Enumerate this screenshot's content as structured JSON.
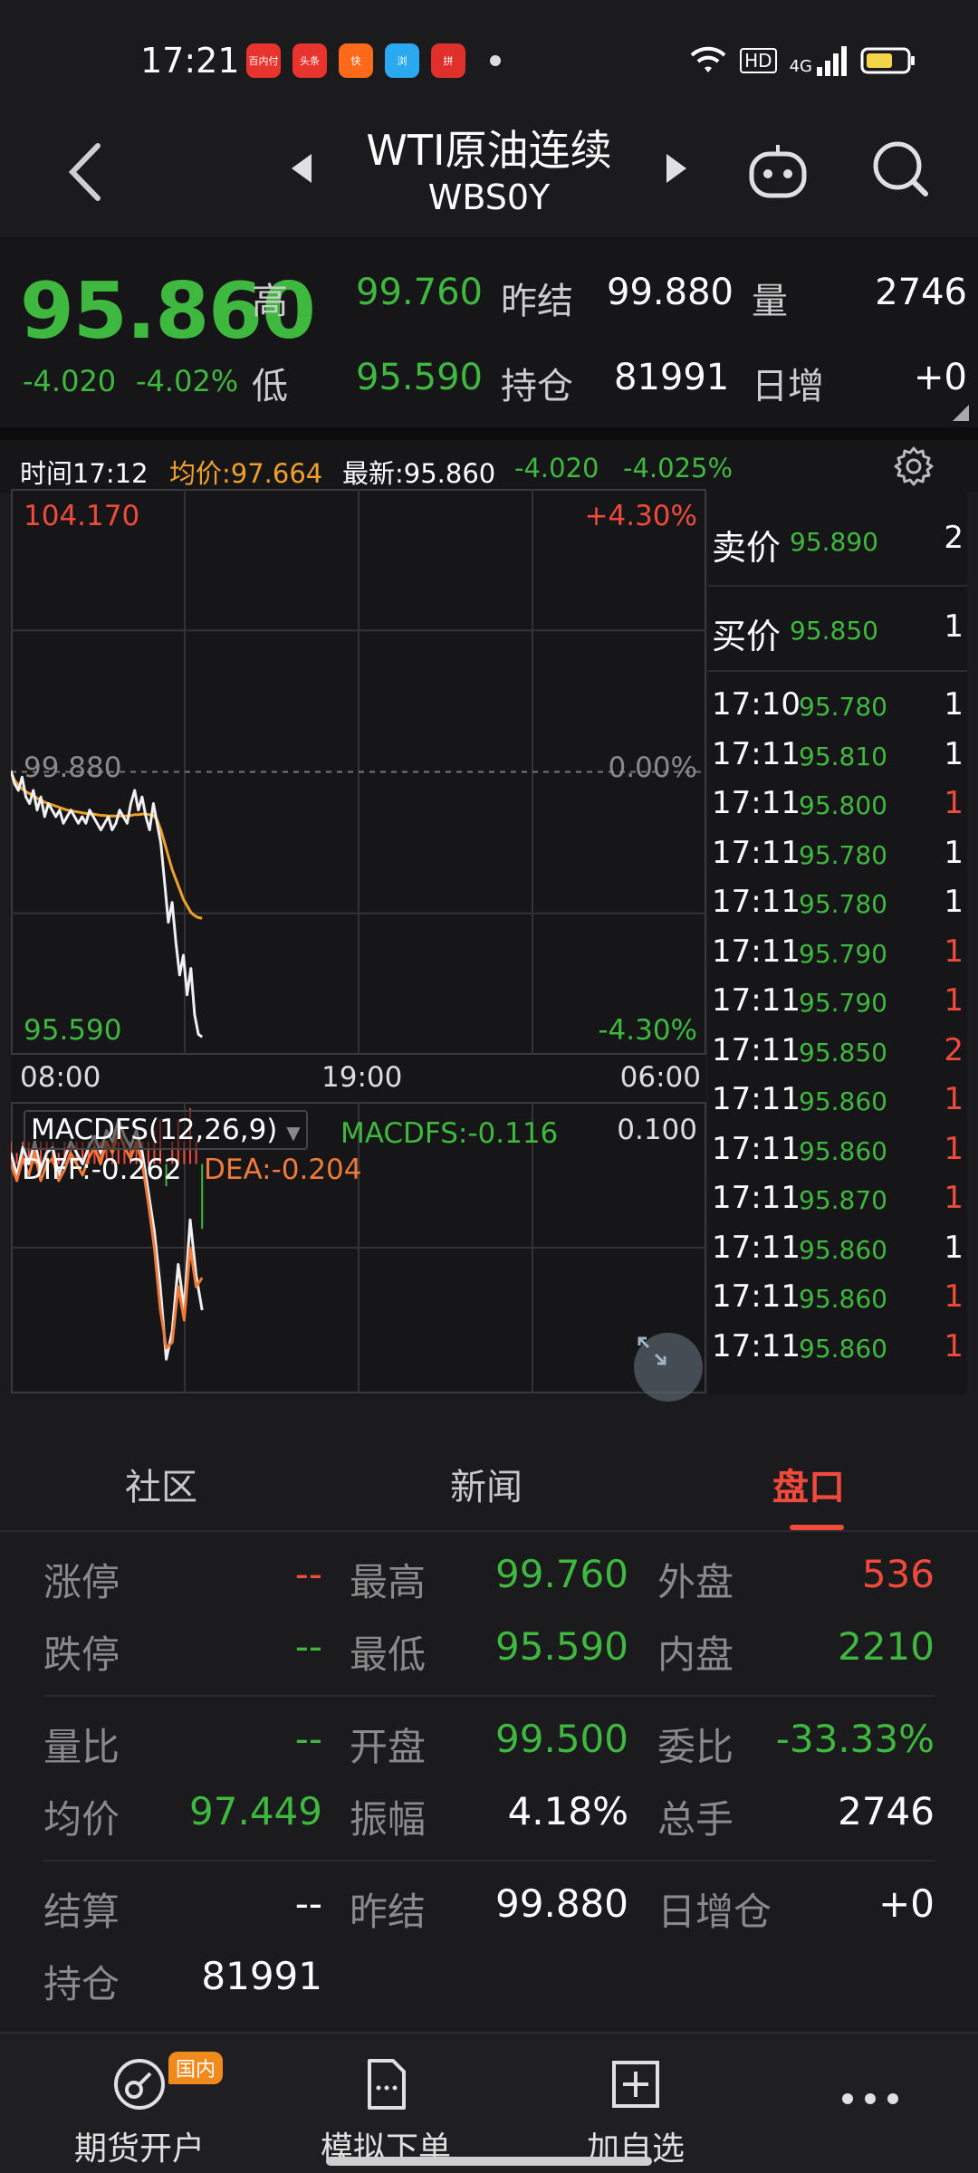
{
  "status_bar": {
    "time": "17:21",
    "apps": [
      {
        "name": "baidu-app-icon",
        "color": "#e8342c",
        "label": "百内付"
      },
      {
        "name": "toutiao-app-icon",
        "color": "#e8342c",
        "label": "头条"
      },
      {
        "name": "kuaishou-app-icon",
        "color": "#ff6a1a",
        "label": "快"
      },
      {
        "name": "browser-app-icon",
        "color": "#2aa8f0",
        "label": "浏"
      },
      {
        "name": "pinduoduo-app-icon",
        "color": "#e0302c",
        "label": "拼"
      }
    ],
    "network": "4G",
    "hd": "HD"
  },
  "nav": {
    "title": "WTI原油连续",
    "code": "WBS0Y"
  },
  "quote": {
    "price": "95.860",
    "change": "-4.020",
    "change_pct": "-4.02%",
    "high_label": "高",
    "high": "99.760",
    "low_label": "低",
    "low": "95.590",
    "prev_close_label": "昨结",
    "prev_close": "99.880",
    "open_interest_label": "持仓",
    "open_interest": "81991",
    "volume_label": "量",
    "volume": "2746",
    "daily_inc_label": "日增",
    "daily_inc": "+0"
  },
  "info_line": {
    "time": "时间17:12",
    "avg": "均价:97.664",
    "latest": "最新:95.860",
    "change": "-4.020",
    "change_pct": "-4.025%"
  },
  "chart_data": [
    {
      "type": "line",
      "title": "",
      "ylim": [
        95.59,
        104.17
      ],
      "y_top_label": "104.170",
      "y_mid_label": "99.880",
      "y_bottom_label": "95.590",
      "pct_top_label": "+4.30%",
      "pct_mid_label": "0.00%",
      "pct_bottom_label": "-4.30%",
      "x_tick_labels": [
        "08:00",
        "19:00",
        "06:00"
      ],
      "series": [
        {
          "name": "",
          "color": "#f0f0f0",
          "values": [
            99.9,
            99.7,
            99.6,
            99.8,
            99.5,
            99.4,
            99.6,
            99.3,
            99.5,
            99.2,
            99.4,
            99.3,
            99.2,
            99.3,
            99.1,
            99.2,
            99.3,
            99.2,
            99.1,
            99.2,
            99.1,
            99.3,
            99.2,
            99.1,
            99.0,
            99.1,
            99.2,
            99.0,
            99.1,
            99.3,
            99.2,
            99.1,
            99.4,
            99.6,
            99.3,
            99.5,
            99.2,
            99.0,
            99.4,
            99.1,
            98.8,
            98.2,
            97.6,
            97.9,
            97.3,
            96.8,
            97.1,
            96.5,
            96.9,
            96.2,
            95.9,
            95.86
          ]
        },
        {
          "name": "",
          "color": "#f0a02a",
          "values": [
            99.88,
            99.75,
            99.68,
            99.62,
            99.58,
            99.55,
            99.52,
            99.48,
            99.45,
            99.42,
            99.4,
            99.38,
            99.36,
            99.34,
            99.32,
            99.3,
            99.29,
            99.28,
            99.27,
            99.26,
            99.25,
            99.24,
            99.24,
            99.23,
            99.22,
            99.22,
            99.21,
            99.21,
            99.21,
            99.21,
            99.21,
            99.21,
            99.22,
            99.23,
            99.23,
            99.24,
            99.24,
            99.23,
            99.22,
            99.15,
            99.0,
            98.8,
            98.6,
            98.4,
            98.25,
            98.1,
            97.95,
            97.85,
            97.75,
            97.7,
            97.67,
            97.66
          ]
        }
      ]
    },
    {
      "type": "line",
      "title": "",
      "indicator_label": "MACDFS(12,26,9)",
      "macdfs_label": "MACDFS:-0.116",
      "diff_label": "DIFF:-0.262",
      "dea_label": "DEA:-0.204",
      "y_top_label": "0.100",
      "series": [
        {
          "name": "DIFF",
          "color": "#f0f0f0",
          "values": [
            0.02,
            -0.02,
            0.03,
            0.0,
            0.04,
            -0.01,
            0.02,
            0.03,
            -0.02,
            0.01,
            0.04,
            0.02,
            0.0,
            0.03,
            0.05,
            0.02,
            0.06,
            0.04,
            0.08,
            0.05,
            0.03,
            0.06,
            0.02,
            -0.05,
            -0.12,
            -0.22,
            -0.35,
            -0.3,
            -0.18,
            -0.26,
            -0.1,
            -0.2,
            -0.262
          ]
        },
        {
          "name": "DEA",
          "color": "#f07a3a",
          "values": [
            0.0,
            -0.03,
            0.01,
            -0.02,
            0.02,
            -0.03,
            0.0,
            0.01,
            -0.03,
            -0.01,
            0.02,
            0.0,
            -0.02,
            0.01,
            0.03,
            0.0,
            0.04,
            0.02,
            0.06,
            0.03,
            0.01,
            0.04,
            0.0,
            -0.07,
            -0.15,
            -0.26,
            -0.33,
            -0.32,
            -0.22,
            -0.28,
            -0.15,
            -0.22,
            -0.204
          ]
        }
      ]
    }
  ],
  "order_book": {
    "ask_label": "卖价",
    "ask_price": "95.890",
    "ask_vol": "2",
    "bid_label": "买价",
    "bid_price": "95.850",
    "bid_vol": "1",
    "ticks": [
      {
        "time": "17:10",
        "price": "95.780",
        "vol": "1",
        "color": "#ffffff"
      },
      {
        "time": "17:11",
        "price": "95.810",
        "vol": "1",
        "color": "#ffffff"
      },
      {
        "time": "17:11",
        "price": "95.800",
        "vol": "1",
        "color": "#f04a3c"
      },
      {
        "time": "17:11",
        "price": "95.780",
        "vol": "1",
        "color": "#ffffff"
      },
      {
        "time": "17:11",
        "price": "95.780",
        "vol": "1",
        "color": "#ffffff"
      },
      {
        "time": "17:11",
        "price": "95.790",
        "vol": "1",
        "color": "#f04a3c"
      },
      {
        "time": "17:11",
        "price": "95.790",
        "vol": "1",
        "color": "#f04a3c"
      },
      {
        "time": "17:11",
        "price": "95.850",
        "vol": "2",
        "color": "#f04a3c"
      },
      {
        "time": "17:11",
        "price": "95.860",
        "vol": "1",
        "color": "#f04a3c"
      },
      {
        "time": "17:11",
        "price": "95.860",
        "vol": "1",
        "color": "#f04a3c"
      },
      {
        "time": "17:11",
        "price": "95.870",
        "vol": "1",
        "color": "#f04a3c"
      },
      {
        "time": "17:11",
        "price": "95.860",
        "vol": "1",
        "color": "#ffffff"
      },
      {
        "time": "17:11",
        "price": "95.860",
        "vol": "1",
        "color": "#f04a3c"
      },
      {
        "time": "17:11",
        "price": "95.860",
        "vol": "1",
        "color": "#f04a3c"
      }
    ]
  },
  "tabs": [
    {
      "label": "社区"
    },
    {
      "label": "新闻"
    },
    {
      "label": "盘口"
    }
  ],
  "stats": {
    "limit_up_label": "涨停",
    "limit_up": "--",
    "limit_down_label": "跌停",
    "limit_down": "--",
    "vol_ratio_label": "量比",
    "vol_ratio": "--",
    "avg_label": "均价",
    "avg": "97.449",
    "settle_label": "结算",
    "settle": "--",
    "oi_label": "持仓",
    "oi": "81991",
    "high_label": "最高",
    "high": "99.760",
    "low_label": "最低",
    "low": "95.590",
    "open_label": "开盘",
    "open": "99.500",
    "amp_label": "振幅",
    "amp": "4.18%",
    "prev_label": "昨结",
    "prev": "99.880",
    "outer_label": "外盘",
    "outer": "536",
    "inner_label": "内盘",
    "inner": "2210",
    "commit_label": "委比",
    "commit": "-33.33%",
    "total_label": "总手",
    "total": "2746",
    "daily_label": "日增仓",
    "daily": "+0"
  },
  "bottom_bar": {
    "open_account": "期货开户",
    "badge": "国内",
    "sim_order": "模拟下单",
    "add_fav": "加自选"
  }
}
